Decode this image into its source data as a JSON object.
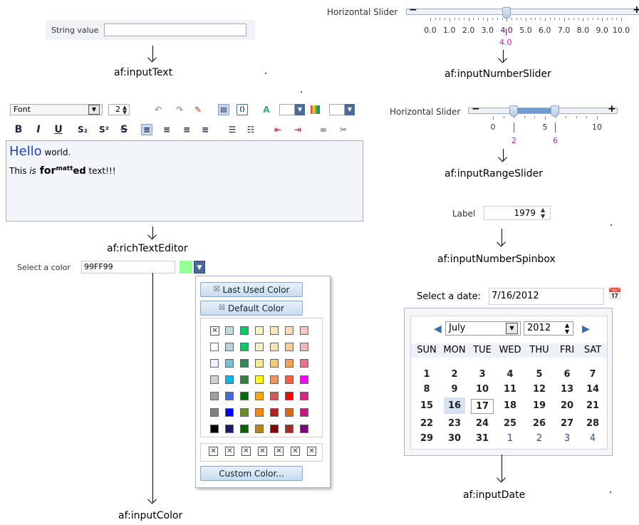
{
  "input_text": {
    "label": "String value",
    "value": "",
    "caption": "af:inputText"
  },
  "number_slider": {
    "label": "Horizontal Slider",
    "minus": "−",
    "plus": "+",
    "ticks": [
      "0.0",
      "1.0",
      "2.0",
      "3.0",
      "4.0",
      "5.0",
      "6.0",
      "7.0",
      "8.0",
      "9.0",
      "10.0"
    ],
    "value": "4.0",
    "value_fraction": 0.4,
    "caption": "af:inputNumberSlider"
  },
  "range_slider": {
    "label": "Horizontal Slider",
    "minus": "−",
    "plus": "+",
    "ticks": [
      "0",
      "5",
      "10"
    ],
    "low": "2",
    "high": "6",
    "caption": "af:inputRangeSlider"
  },
  "spinbox": {
    "label": "Label",
    "value": "1979",
    "caption": "af:inputNumberSpinbox"
  },
  "rich_text": {
    "font_select": "Font",
    "size_value": "2",
    "toolbar_row2": [
      "B",
      "I",
      "U",
      "S₂",
      "S²",
      "S"
    ],
    "line1_big": "Hello",
    "line1_rest": " world.",
    "line2_a": "This ",
    "line2_is": "is",
    "line2_for": " for",
    "line2_sup": "matt",
    "line2_ed": "ed",
    "line2_end": " text!!!",
    "caption": "af:richTextEditor"
  },
  "input_color": {
    "label": "Select a color",
    "value": "99FF99",
    "swatch_color": "#99ff99",
    "last_used": "Last Used Color",
    "default": "Default Color",
    "custom": "Custom Color...",
    "caption": "af:inputColor",
    "grid": [
      [
        "none",
        "#b9dede",
        "#00cc66",
        "#fbf3c8",
        "#fce8c0",
        "#fbdcb8",
        "#f9c6c6"
      ],
      [
        "#ffffff",
        "#b4d4e0",
        "#00cc66",
        "#f6f2c6",
        "#f8e2bc",
        "#f7ce9e",
        "#f6b6bb"
      ],
      [
        "#f3f3ff",
        "#79bfd7",
        "#2e8b57",
        "#f4eb96",
        "#f5c97a",
        "#f2a157",
        "#e8738d"
      ],
      [
        "#d0d0d0",
        "#00b7ef",
        "#2f7f46",
        "#ffff00",
        "#f49468",
        "#ff5c4a",
        "#ff00ff"
      ],
      [
        "#a0a0a0",
        "#4169e1",
        "#006b00",
        "#ffa500",
        "#ce5a5a",
        "#ff0000",
        "#e0218a"
      ],
      [
        "#808080",
        "#0000ff",
        "#6b8e23",
        "#ff8c00",
        "#b22222",
        "#d2691e",
        "#c71585"
      ],
      [
        "#000000",
        "#191970",
        "#006400",
        "#b8860b",
        "#8b0000",
        "#a52a2a",
        "#800080"
      ]
    ]
  },
  "input_date": {
    "label": "Select a date:",
    "value": "7/16/2012",
    "month": "July",
    "year": "2012",
    "day_names": [
      "SUN",
      "MON",
      "TUE",
      "WED",
      "THU",
      "FRI",
      "SAT"
    ],
    "weeks": [
      [
        "1",
        "2",
        "3",
        "4",
        "5",
        "6",
        "7"
      ],
      [
        "8",
        "9",
        "10",
        "11",
        "12",
        "13",
        "14"
      ],
      [
        "15",
        "16",
        "17",
        "18",
        "19",
        "20",
        "21"
      ],
      [
        "22",
        "23",
        "24",
        "25",
        "26",
        "27",
        "28"
      ],
      [
        "29",
        "30",
        "31",
        "1",
        "2",
        "3",
        "4"
      ]
    ],
    "selected": "16",
    "today": "17",
    "caption": "af:inputDate"
  },
  "colors": {
    "accent": "#c8daf0",
    "magenta": "#c0209b",
    "hello": "#2040c0"
  }
}
